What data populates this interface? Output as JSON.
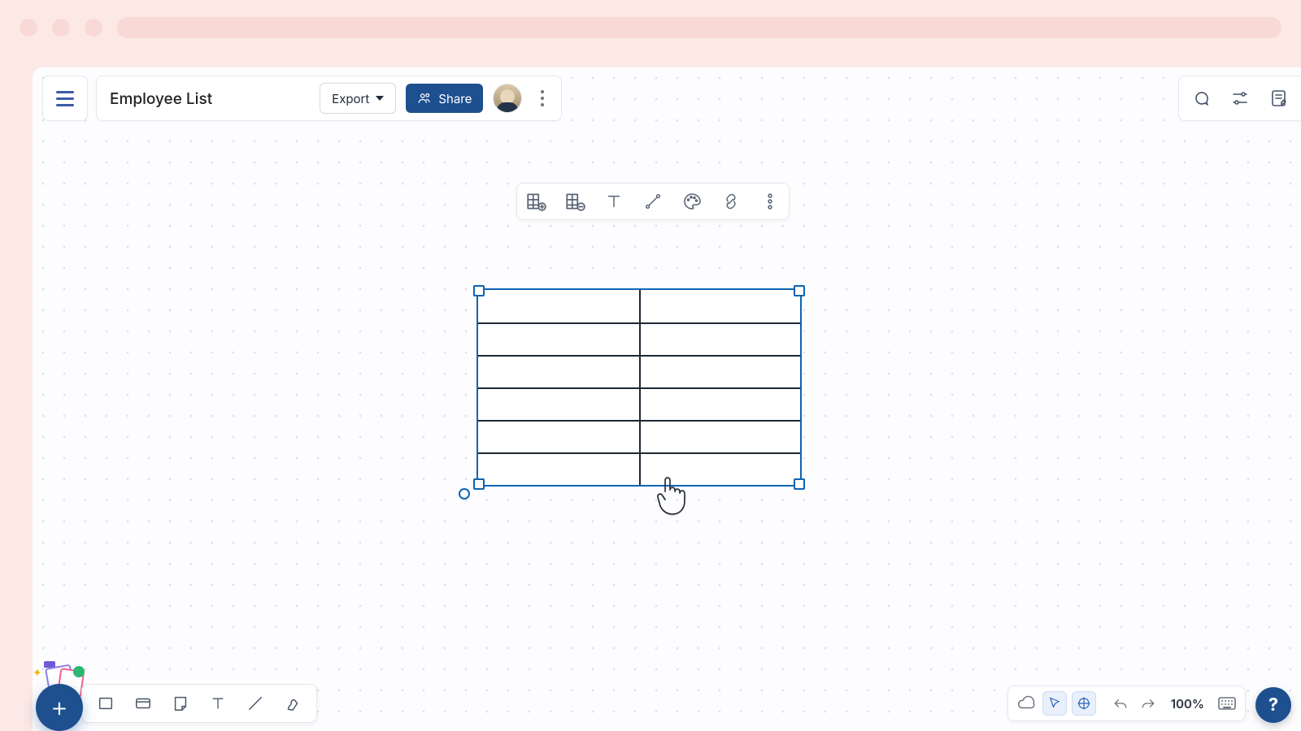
{
  "document": {
    "title": "Employee List"
  },
  "header": {
    "export_label": "Export",
    "share_label": "Share"
  },
  "context_toolbar": {
    "items": [
      "add-column",
      "remove-column",
      "text",
      "connector",
      "color",
      "link",
      "more"
    ]
  },
  "table": {
    "rows": 6,
    "cols": 2
  },
  "zoom": {
    "label": "100%"
  }
}
